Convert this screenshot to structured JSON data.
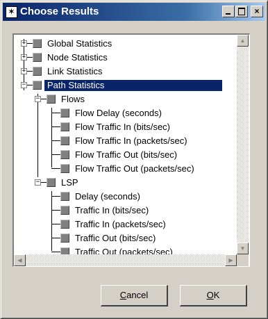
{
  "window": {
    "title": "Choose Results",
    "title_icon": "asterisk-icon",
    "controls": {
      "minimize": "_",
      "maximize": "□",
      "close": "×"
    }
  },
  "tree": {
    "items": [
      {
        "label": "Global Statistics",
        "expander": "+",
        "selected": false
      },
      {
        "label": "Node Statistics",
        "expander": "+",
        "selected": false
      },
      {
        "label": "Link Statistics",
        "expander": "+",
        "selected": false
      },
      {
        "label": "Path Statistics",
        "expander": "−",
        "selected": true
      },
      {
        "label": "Flows",
        "expander": "−",
        "selected": false
      },
      {
        "label": "Flow Delay (seconds)",
        "selected": false
      },
      {
        "label": "Flow Traffic In (bits/sec)",
        "selected": false
      },
      {
        "label": "Flow Traffic In (packets/sec)",
        "selected": false
      },
      {
        "label": "Flow Traffic Out (bits/sec)",
        "selected": false
      },
      {
        "label": "Flow Traffic Out (packets/sec)",
        "selected": false
      },
      {
        "label": "LSP",
        "expander": "−",
        "selected": false
      },
      {
        "label": "Delay (seconds)",
        "selected": false
      },
      {
        "label": "Traffic In (bits/sec)",
        "selected": false
      },
      {
        "label": "Traffic In (packets/sec)",
        "selected": false
      },
      {
        "label": "Traffic Out (bits/sec)",
        "selected": false
      },
      {
        "label": "Traffic Out (packets/sec)",
        "selected": false
      }
    ]
  },
  "scrollbar": {
    "up": "▲",
    "down": "▼",
    "left": "◀",
    "right": "▶"
  },
  "buttons": {
    "cancel": {
      "accel": "C",
      "rest": "ancel"
    },
    "ok": {
      "accel": "O",
      "rest": "K"
    }
  }
}
